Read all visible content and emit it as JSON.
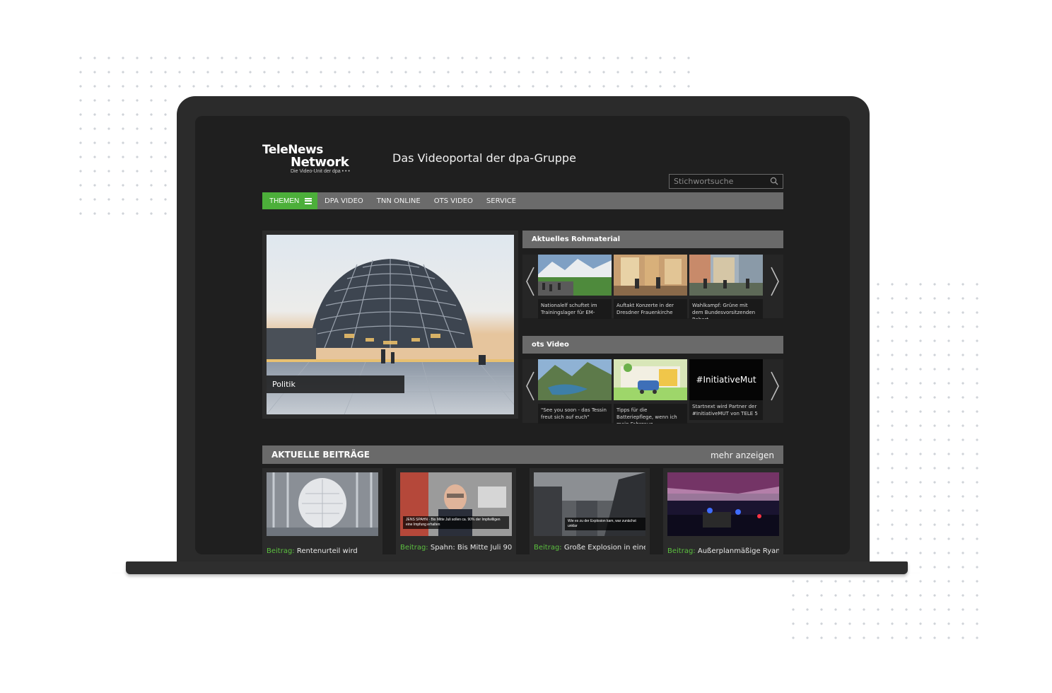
{
  "brand": {
    "line1": "TeleNews",
    "line2": "Network",
    "line3": "Die Video-Unit der dpa • • •",
    "tagline": "Das Videoportal der dpa-Gruppe"
  },
  "search": {
    "placeholder": "Stichwortsuche"
  },
  "nav": {
    "themen": "THEMEN",
    "items": [
      "DPA VIDEO",
      "TNN ONLINE",
      "OTS VIDEO",
      "SERVICE"
    ]
  },
  "hero": {
    "caption": "Politik"
  },
  "rohmaterial": {
    "title": "Aktuelles Rohmaterial",
    "items": [
      {
        "caption": "Nationalelf schuftet im Trainingslager für EM-"
      },
      {
        "caption": "Auftakt Konzerte in der Dresdner Frauenkirche"
      },
      {
        "caption": "Wahlkampf: Grüne mit dem Bundesvorsitzenden Robert"
      }
    ]
  },
  "ots": {
    "title": "ots Video",
    "items": [
      {
        "caption": "\"See you soon - das Tessin freut sich auf euch\""
      },
      {
        "caption": "Tipps für die Batteriepflege, wenn ich mein Fahrzeug"
      },
      {
        "caption": "Startnext wird Partner der #InitiativeMUT von TELE 5"
      }
    ],
    "mut_text": "#InitiativeMut"
  },
  "beitraege": {
    "title": "AKTUELLE BEITRÄGE",
    "more": "mehr anzeigen",
    "prefix": "Beitrag:",
    "items": [
      {
        "title": "Rentenurteil wird"
      },
      {
        "title": "Spahn: Bis Mitte Juli 90"
      },
      {
        "title": "Große Explosion in einem"
      },
      {
        "title": "Außerplanmäßige Ryanair-"
      }
    ],
    "overlay_spahn_name": "JENS SPAHN",
    "overlay_spahn_text": "Bis Mitte Juli sollen ca. 90% der Impfwilligen eine Impfung erhalten",
    "overlay_explosion": "Wie es zu der Explosion kam, war zunächst unklar"
  },
  "colors": {
    "accent": "#4caf3a",
    "panel": "#6a6a6a",
    "screen_bg": "#1f1f1f"
  }
}
